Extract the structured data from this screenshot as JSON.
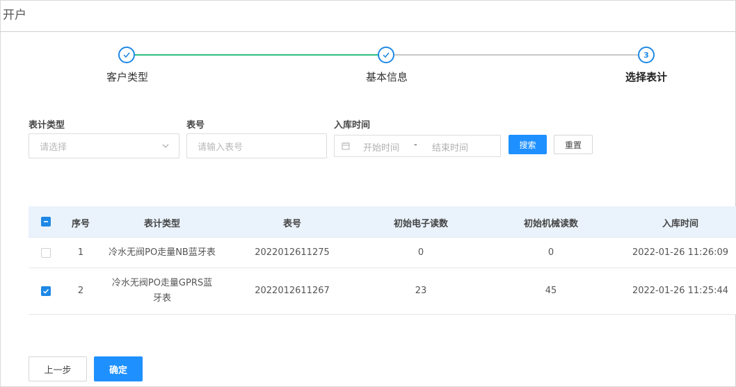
{
  "header": {
    "title": "开户"
  },
  "steps": [
    {
      "label": "客户类型",
      "status": "done"
    },
    {
      "label": "基本信息",
      "status": "done"
    },
    {
      "label": "选择表计",
      "status": "active",
      "number": "3"
    }
  ],
  "filters": {
    "meter_type": {
      "label": "表计类型",
      "placeholder": "请选择"
    },
    "meter_no": {
      "label": "表号",
      "placeholder": "请输入表号"
    },
    "stock_time": {
      "label": "入库时间",
      "start_placeholder": "开始时间",
      "separator": "-",
      "end_placeholder": "结束时间"
    },
    "search_label": "搜索",
    "reset_label": "重置"
  },
  "table": {
    "columns": [
      "序号",
      "表计类型",
      "表号",
      "初始电子读数",
      "初始机械读数",
      "入库时间"
    ],
    "rows": [
      {
        "checked": false,
        "index": "1",
        "type_line1": "冷水无阀PO走量NB蓝牙表",
        "type_line2": "",
        "meter_no": "2022012611275",
        "electronic": "0",
        "mechanical": "0",
        "time": "2022-01-26 11:26:09"
      },
      {
        "checked": true,
        "index": "2",
        "type_line1": "冷水无阀PO走量GPRS蓝",
        "type_line2": "牙表",
        "meter_no": "2022012611267",
        "electronic": "23",
        "mechanical": "45",
        "time": "2022-01-26 11:25:44"
      }
    ]
  },
  "footer": {
    "prev_label": "上一步",
    "confirm_label": "确定"
  },
  "colors": {
    "primary": "#1e90ff",
    "step_done_line": "#2dbd7f",
    "table_header_bg": "#eaf3fc"
  }
}
